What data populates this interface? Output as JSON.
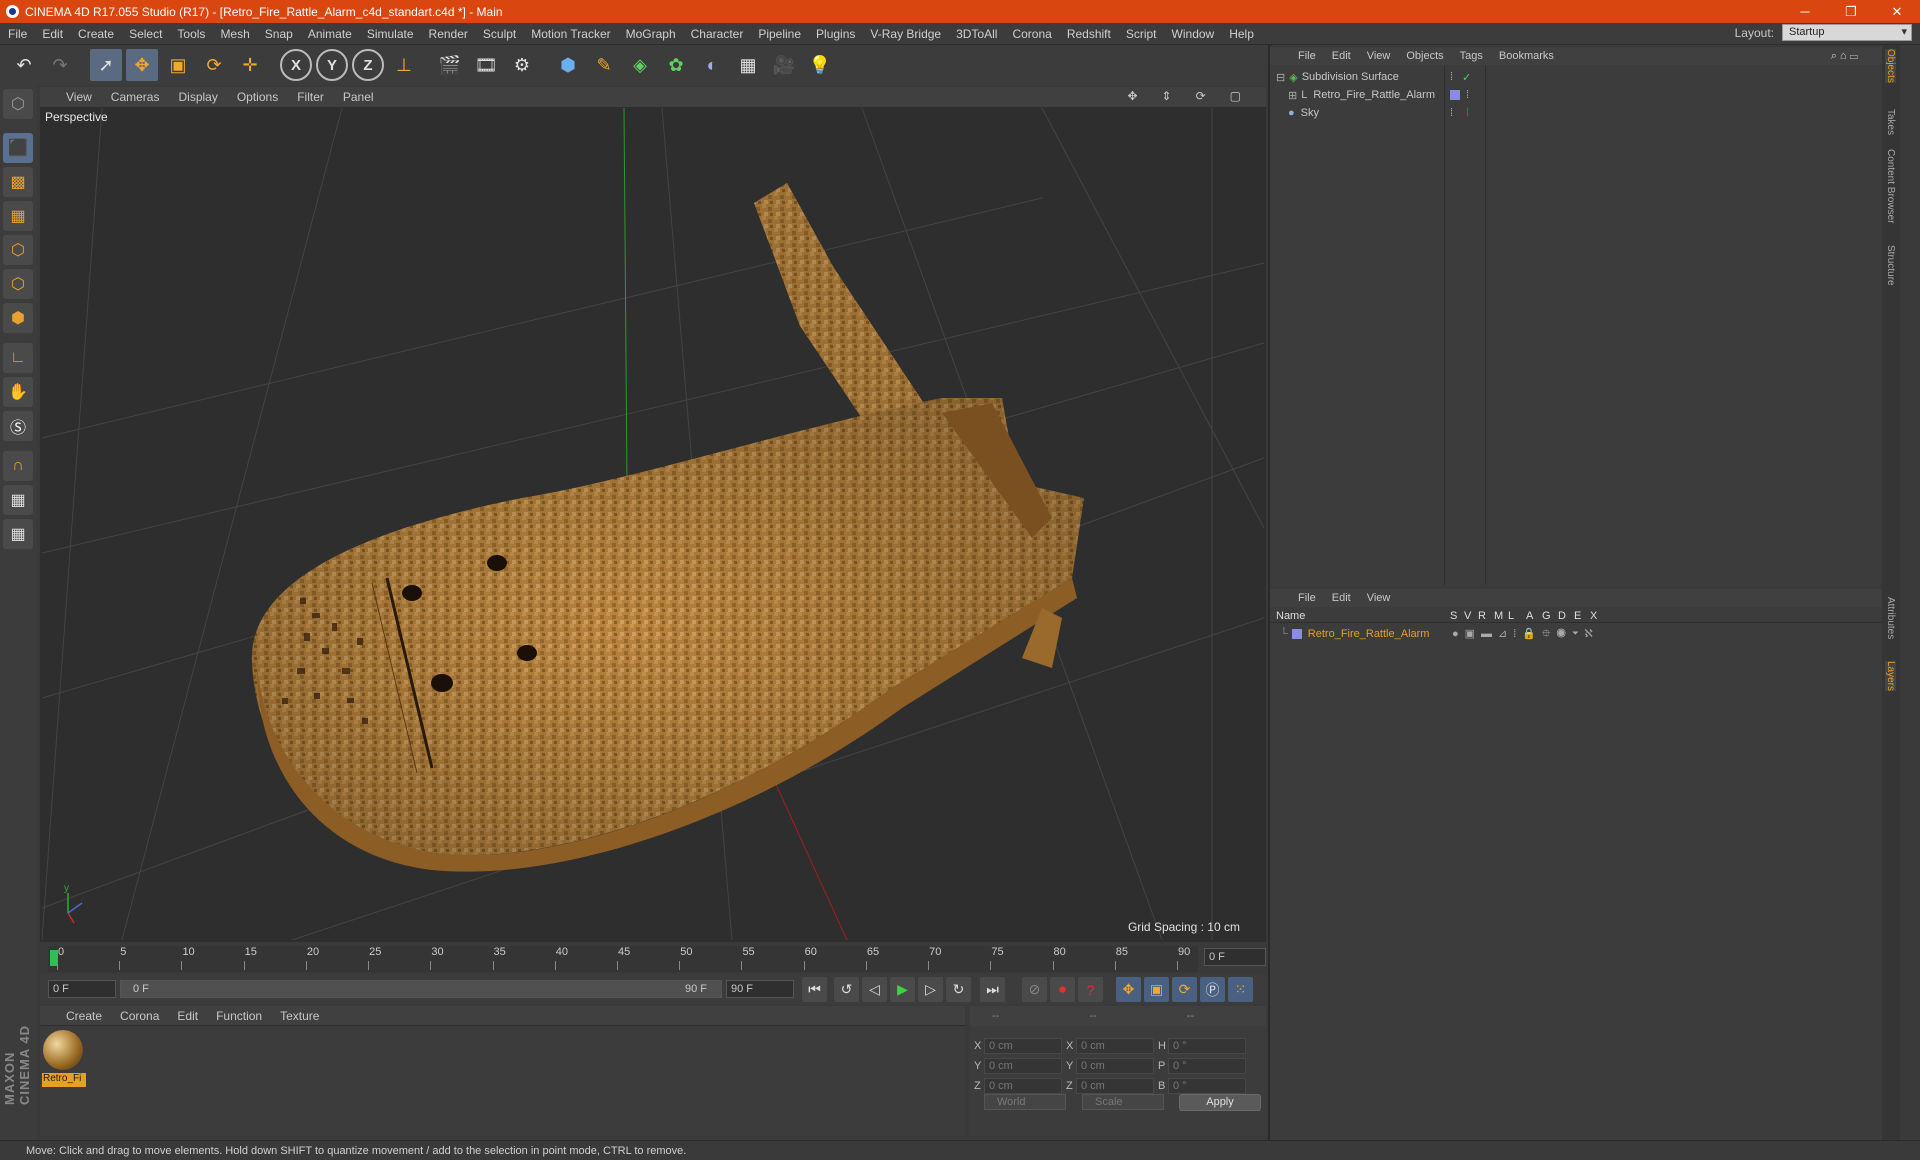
{
  "window": {
    "title": "CINEMA 4D R17.055 Studio (R17) - [Retro_Fire_Rattle_Alarm_c4d_standart.c4d *] - Main",
    "minimize": "─",
    "maximize": "❐",
    "close": "✕"
  },
  "menubar": {
    "items": [
      "File",
      "Edit",
      "Create",
      "Select",
      "Tools",
      "Mesh",
      "Snap",
      "Animate",
      "Simulate",
      "Render",
      "Sculpt",
      "Motion Tracker",
      "MoGraph",
      "Character",
      "Pipeline",
      "Plugins",
      "V-Ray Bridge",
      "3DToAll",
      "Corona",
      "Redshift",
      "Script",
      "Window",
      "Help"
    ],
    "layout_label": "Layout:",
    "layout_value": "Startup"
  },
  "toolbar": {
    "icons": [
      "undo-icon",
      "redo-icon",
      "select-pointer-icon",
      "move-icon",
      "scale-icon",
      "rotate-icon",
      "world-axis-icon",
      "x-axis-icon",
      "y-axis-icon",
      "z-axis-icon",
      "coordinate-system-icon",
      "render-view-icon",
      "render-picture-viewer-icon",
      "render-settings-icon",
      "cube-icon",
      "pen-spline-icon",
      "subdivision-icon",
      "cloner-icon",
      "deformer-icon",
      "floor-icon",
      "camera-icon",
      "light-icon"
    ],
    "xyz": [
      "X",
      "Y",
      "Z"
    ]
  },
  "viewport": {
    "menu": [
      "View",
      "Cameras",
      "Display",
      "Options",
      "Filter",
      "Panel"
    ],
    "label": "Perspective",
    "grid_spacing": "Grid Spacing : 10 cm"
  },
  "timeline": {
    "ticks": [
      "0",
      "5",
      "10",
      "15",
      "20",
      "25",
      "30",
      "35",
      "40",
      "45",
      "50",
      "55",
      "60",
      "65",
      "70",
      "75",
      "80",
      "85",
      "90"
    ],
    "current_frame": "0 F"
  },
  "playbar": {
    "start": "0 F",
    "range_start": "0 F",
    "range_end": "90 F",
    "end": "90 F"
  },
  "material": {
    "menu": [
      "Create",
      "Corona",
      "Edit",
      "Function",
      "Texture"
    ],
    "item_name": "Retro_Fi"
  },
  "coords": {
    "header": [
      "--",
      "--",
      "--"
    ],
    "rows": [
      {
        "a": "X",
        "av": "0 cm",
        "b": "X",
        "bv": "0 cm",
        "c": "H",
        "cv": "0 °"
      },
      {
        "a": "Y",
        "av": "0 cm",
        "b": "Y",
        "bv": "0 cm",
        "c": "P",
        "cv": "0 °"
      },
      {
        "a": "Z",
        "av": "0 cm",
        "b": "Z",
        "bv": "0 cm",
        "c": "B",
        "cv": "0 °"
      }
    ],
    "world": "World",
    "scale": "Scale",
    "apply": "Apply"
  },
  "objects": {
    "menu": [
      "File",
      "Edit",
      "View",
      "Objects",
      "Tags",
      "Bookmarks"
    ],
    "items": [
      {
        "name": "Subdivision Surface"
      },
      {
        "name": "Retro_Fire_Rattle_Alarm"
      },
      {
        "name": "Sky"
      }
    ]
  },
  "layers": {
    "menu": [
      "File",
      "Edit",
      "View"
    ],
    "col_name": "Name",
    "cols": [
      "S",
      "V",
      "R",
      "M",
      "L",
      "A",
      "G",
      "D",
      "E",
      "X"
    ],
    "item": "Retro_Fire_Rattle_Alarm"
  },
  "sidetabs": [
    "Objects",
    "Takes",
    "Content Browser",
    "Structure",
    "Attributes",
    "Layers"
  ],
  "status": "Move: Click and drag to move elements. Hold down SHIFT to quantize movement / add to the selection in point mode, CTRL to remove.",
  "branding": "MAXON CINEMA 4D",
  "colors": {
    "title_bar": "#d9460f",
    "accent": "#e8a020",
    "wood": "#b88440"
  }
}
